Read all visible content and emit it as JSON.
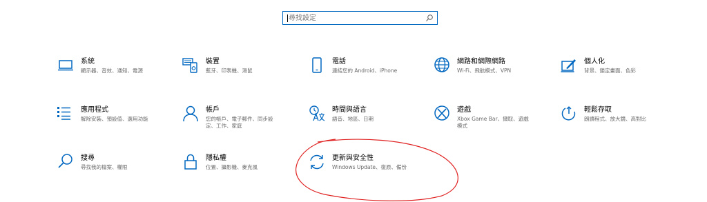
{
  "search": {
    "placeholder": "尋找設定"
  },
  "tiles": [
    {
      "title": "系統",
      "desc": "顯示器、音效、通知、電源",
      "icon": "laptop-icon"
    },
    {
      "title": "裝置",
      "desc": "藍牙、印表機、滑鼠",
      "icon": "devices-icon"
    },
    {
      "title": "電話",
      "desc": "連結您的 Android、iPhone",
      "icon": "phone-icon"
    },
    {
      "title": "網路和網際網路",
      "desc": "Wi-Fi、飛航模式、VPN",
      "icon": "globe-icon"
    },
    {
      "title": "個人化",
      "desc": "背景、鎖定畫面、色彩",
      "icon": "personalization-icon"
    },
    {
      "title": "應用程式",
      "desc": "解除安裝、預設值、選用功能",
      "icon": "apps-list-icon"
    },
    {
      "title": "帳戶",
      "desc": "您的帳戶、電子郵件、同步設定、工作、家庭",
      "icon": "person-icon"
    },
    {
      "title": "時間與語言",
      "desc": "語音、地區、日期",
      "icon": "time-language-icon"
    },
    {
      "title": "遊戲",
      "desc": "Xbox Game Bar、擷取、遊戲模式",
      "icon": "xbox-icon"
    },
    {
      "title": "輕鬆存取",
      "desc": "朗讀程式、放大鏡、高對比",
      "icon": "ease-of-access-icon"
    },
    {
      "title": "搜尋",
      "desc": "尋找我的檔案、權限",
      "icon": "search-icon"
    },
    {
      "title": "隱私權",
      "desc": "位置、攝影機、麥克風",
      "icon": "lock-icon"
    },
    {
      "title": "更新與安全性",
      "desc": "Windows Update、復原、備份",
      "icon": "sync-icon"
    }
  ],
  "colors": {
    "accent": "#0067c0",
    "annotation": "#e02020"
  }
}
